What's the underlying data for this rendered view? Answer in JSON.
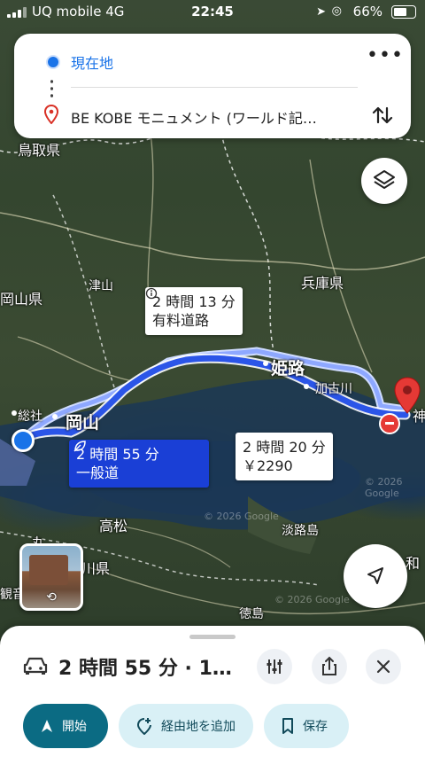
{
  "status_bar": {
    "carrier": "UQ mobile",
    "network": "4G",
    "time": "22:45",
    "battery": "66%"
  },
  "route_card": {
    "origin": "現在地",
    "destination": "BE KOBE モニュメント (ワールド記…",
    "more_icon": "more-horizontal-icon",
    "swap_icon": "swap-vertical-icon"
  },
  "map": {
    "places": {
      "tottori": "鳥取県",
      "hyogo": "兵庫県",
      "okayama_pref": "岡山県",
      "tsuyama": "津山",
      "himeji": "姫路",
      "kakogawa": "加古川",
      "okayama": "岡山",
      "soja": "総社",
      "takamatsu": "高松",
      "awajishima": "淡路島",
      "tokushima": "徳島",
      "kagawa_partial": "川県",
      "wakayama_partial": "和",
      "marugame_partial": "丸",
      "kobe_partial": "神",
      "kanonji_partial": "観音"
    },
    "watermarks": [
      "© 2026 Google",
      "© 2026 Google",
      "© 2026 Google"
    ],
    "route_options": [
      {
        "time": "2 時間 13 分",
        "note": "有料道路",
        "note_icon": "info-icon"
      },
      {
        "time": "2 時間 55 分",
        "note": "一般道",
        "icon": "leaf-icon",
        "selected": true
      },
      {
        "time": "2 時間 20 分",
        "note": "￥2290"
      }
    ],
    "colors": {
      "route_selected": "#2b55e8",
      "route_alt": "#9bb3ff",
      "origin": "#1a73e8",
      "destination": "#e53935"
    }
  },
  "bottom_sheet": {
    "summary": "2 時間 55 分 · 1…",
    "buttons": {
      "start": "開始",
      "add_stop": "経由地を追加",
      "save": "保存"
    }
  }
}
